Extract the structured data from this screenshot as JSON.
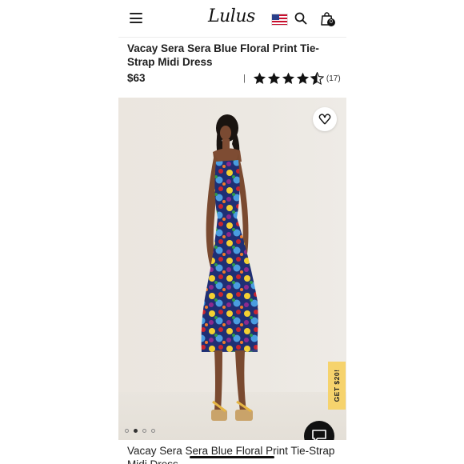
{
  "header": {
    "brand": "Lulus",
    "menu_icon": "hamburger-menu-icon",
    "flag_icon": "us-flag-icon",
    "search_icon": "search-icon",
    "bag_icon": "shopping-bag-icon",
    "bag_count": "0"
  },
  "product": {
    "title": "Vacay Sera Sera Blue Floral Print Tie-Strap Midi Dress",
    "price": "$63",
    "rating_divider": "|",
    "rating": 4.5,
    "review_count": "(17)"
  },
  "gallery": {
    "wishlist_icon": "heart-icon",
    "image_count": 4,
    "active_index": 1
  },
  "promo": {
    "label": "GET $20!"
  },
  "chat": {
    "icon": "chat-bubble-icon"
  },
  "colors": {
    "promo_bg": "#f6d36d",
    "chat_bg": "#111111",
    "star": "#111111"
  }
}
